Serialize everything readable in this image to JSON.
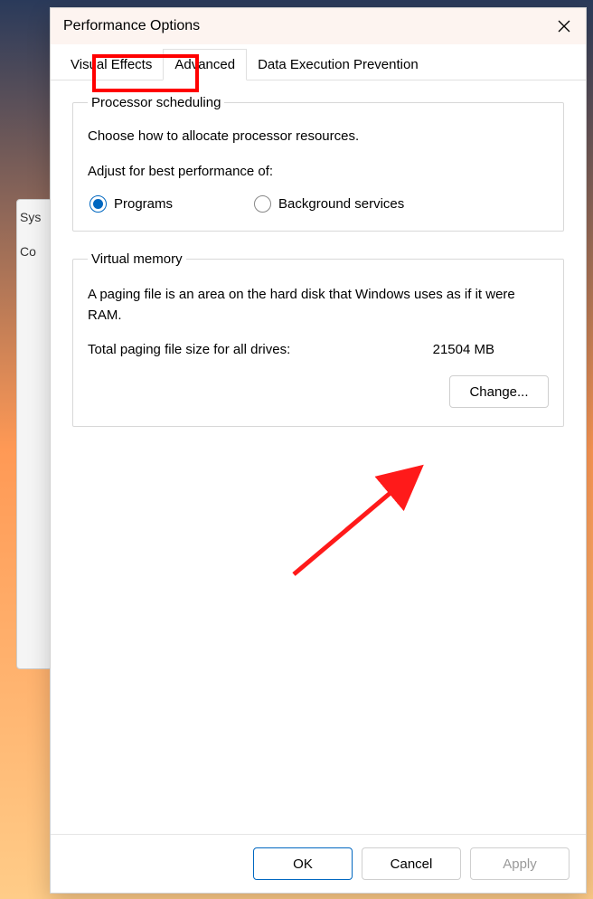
{
  "background": {
    "partial_label1": "Sys",
    "partial_label2": "Co"
  },
  "dialog": {
    "title": "Performance Options",
    "tabs": {
      "visual_effects": "Visual Effects",
      "advanced": "Advanced",
      "dep": "Data Execution Prevention"
    },
    "processor": {
      "legend": "Processor scheduling",
      "desc": "Choose how to allocate processor resources.",
      "subhead": "Adjust for best performance of:",
      "programs_label": "Programs",
      "background_label": "Background services",
      "selected": "programs"
    },
    "virtual_memory": {
      "legend": "Virtual memory",
      "desc": "A paging file is an area on the hard disk that Windows uses as if it were RAM.",
      "total_label": "Total paging file size for all drives:",
      "total_value": "21504 MB",
      "change_button": "Change..."
    },
    "footer": {
      "ok": "OK",
      "cancel": "Cancel",
      "apply": "Apply"
    }
  }
}
